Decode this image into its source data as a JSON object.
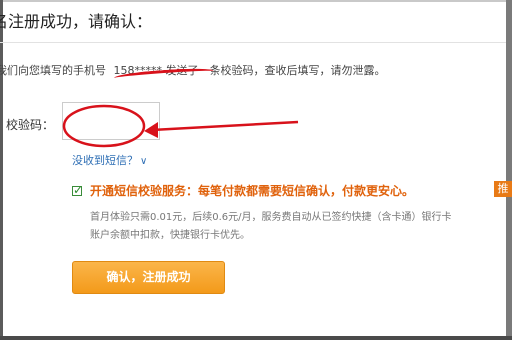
{
  "header": {
    "title": "名注册成功，请确认："
  },
  "info": {
    "prefix": "我们向您填写的手机号",
    "phone": "158*****",
    "suffix": "发送了一条校验码，查收后填写，请勿泄露。"
  },
  "code": {
    "label": "校验码："
  },
  "no_sms": {
    "label": "没收到短信？",
    "chevron_icon": "chevron-down-icon"
  },
  "sms_service": {
    "checked": true,
    "title": "开通短信校验服务：每笔付款都需要短信确认，付款更安心。",
    "badge": "推",
    "desc_line1": "首月体验只需0.01元，后续0.6元/月，服务费自动从已签约快捷（含卡通）银行卡",
    "desc_line2": "账户余额中扣款，快捷银行卡优先。"
  },
  "confirm_button": {
    "label": "确认，注册成功"
  },
  "colors": {
    "accent_orange": "#e0620c",
    "button_orange": "#f39a1a",
    "link_blue": "#2f6fb5",
    "annotation_red": "#d8121b"
  }
}
